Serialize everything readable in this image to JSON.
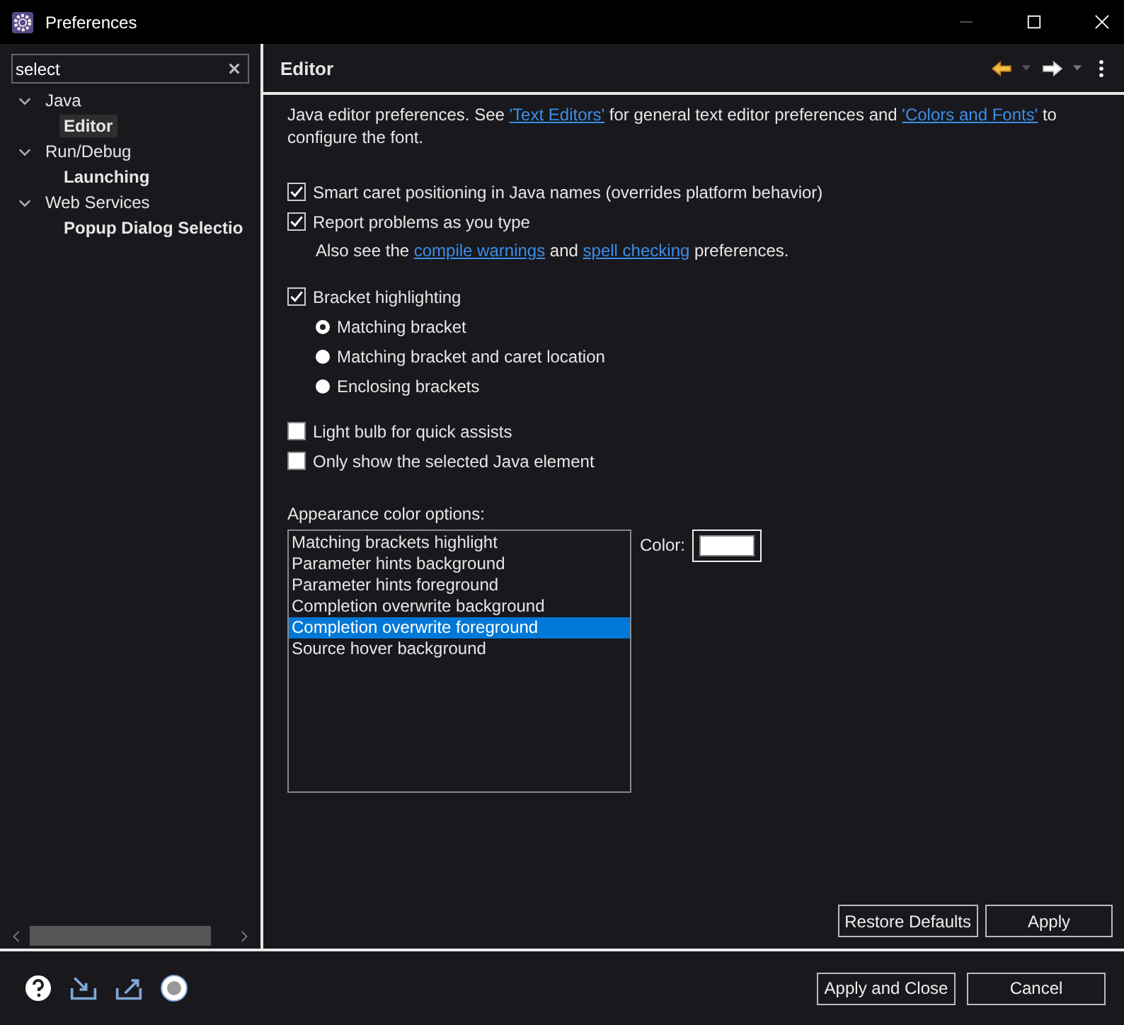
{
  "window": {
    "title": "Preferences"
  },
  "sidebar": {
    "filter": {
      "value": "select"
    },
    "tree": [
      {
        "label": "Java",
        "expanded": true,
        "selected": false,
        "children": [
          {
            "label": "Editor",
            "selected": true
          }
        ]
      },
      {
        "label": "Run/Debug",
        "expanded": true,
        "selected": false,
        "children": [
          {
            "label": "Launching",
            "selected": false
          }
        ]
      },
      {
        "label": "Web Services",
        "expanded": true,
        "selected": false,
        "children": [
          {
            "label": "Popup Dialog Selectio",
            "selected": false
          }
        ]
      }
    ]
  },
  "page": {
    "title": "Editor",
    "description": [
      {
        "kind": "text",
        "text": "Java editor preferences. See "
      },
      {
        "kind": "link",
        "text": "'Text Editors'"
      },
      {
        "kind": "text",
        "text": " for general text editor preferences and "
      },
      {
        "kind": "link",
        "text": "'Colors and Fonts'"
      },
      {
        "kind": "text",
        "text": " to configure the font."
      }
    ],
    "options": [
      {
        "kind": "checkbox",
        "label": "Smart caret positioning in Java names (overrides platform behavior)",
        "checked": true
      },
      {
        "kind": "checkbox",
        "label": "Report problems as you type",
        "checked": true
      },
      {
        "kind": "note",
        "parts": [
          {
            "kind": "text",
            "text": "Also see the "
          },
          {
            "kind": "link",
            "text": "compile warnings"
          },
          {
            "kind": "text",
            "text": " and "
          },
          {
            "kind": "link",
            "text": "spell checking"
          },
          {
            "kind": "text",
            "text": " preferences."
          }
        ]
      },
      {
        "kind": "gap"
      },
      {
        "kind": "checkbox",
        "label": "Bracket highlighting",
        "checked": true
      },
      {
        "kind": "radio",
        "label": "Matching bracket",
        "selected": true
      },
      {
        "kind": "radio",
        "label": "Matching bracket and caret location",
        "selected": false
      },
      {
        "kind": "radio",
        "label": "Enclosing brackets",
        "selected": false
      },
      {
        "kind": "gap"
      },
      {
        "kind": "checkbox",
        "label": "Light bulb for quick assists",
        "checked": false
      },
      {
        "kind": "checkbox",
        "label": "Only show the selected Java element",
        "checked": false
      }
    ],
    "appearance": {
      "label": "Appearance color options:",
      "items": [
        {
          "label": "Matching brackets highlight",
          "selected": false
        },
        {
          "label": "Parameter hints background",
          "selected": false
        },
        {
          "label": "Parameter hints foreground",
          "selected": false
        },
        {
          "label": "Completion overwrite background",
          "selected": false
        },
        {
          "label": "Completion overwrite foreground",
          "selected": true
        },
        {
          "label": "Source hover background",
          "selected": false
        }
      ],
      "color_label": "Color:",
      "color": "#ffffff"
    },
    "buttons": [
      "Restore Defaults",
      "Apply"
    ]
  },
  "footer": {
    "buttons": [
      "Apply and Close",
      "Cancel"
    ]
  }
}
